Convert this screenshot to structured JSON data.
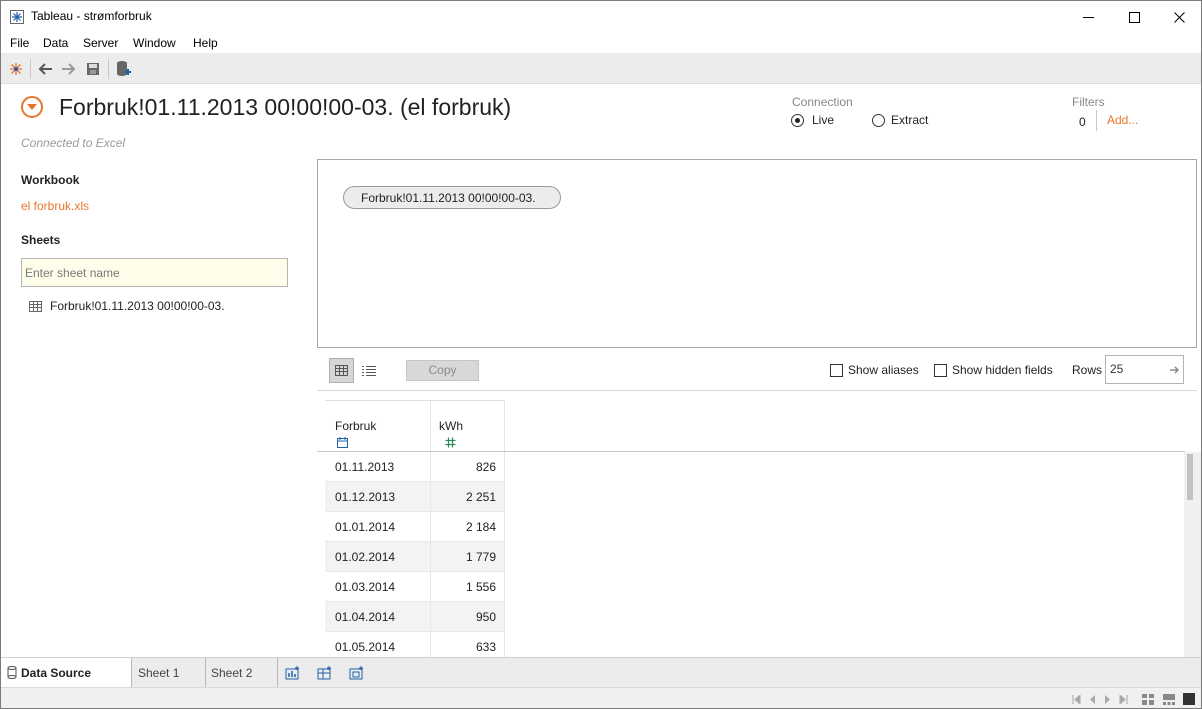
{
  "window": {
    "title": "Tableau - strømforbruk"
  },
  "menu": [
    "File",
    "Data",
    "Server",
    "Window",
    "Help"
  ],
  "datasource": {
    "title": "Forbruk!01.11.2013 00!00!00-03. (el forbruk)",
    "connected_text": "Connected to Excel",
    "connection_label": "Connection",
    "live_label": "Live",
    "extract_label": "Extract",
    "selected_connection": "Live",
    "filters_label": "Filters",
    "filters_count": "0",
    "filters_add": "Add..."
  },
  "left": {
    "workbook_heading": "Workbook",
    "workbook_file": "el forbruk.xls",
    "sheets_heading": "Sheets",
    "sheet_search_placeholder": "Enter sheet name",
    "sheet_item": "Forbruk!01.11.2013 00!00!00-03."
  },
  "canvas": {
    "table_pill": "Forbruk!01.11.2013 00!00!00-03."
  },
  "grid_toolbar": {
    "copy_label": "Copy",
    "show_aliases": "Show aliases",
    "show_hidden": "Show hidden fields",
    "rows_label": "Rows",
    "rows_value": "25"
  },
  "grid": {
    "columns": [
      {
        "name": "Forbruk",
        "type_icon": "calendar-icon"
      },
      {
        "name": "kWh",
        "type_icon": "number-icon"
      }
    ],
    "rows": [
      [
        "01.11.2013",
        "826"
      ],
      [
        "01.12.2013",
        "2 251"
      ],
      [
        "01.01.2014",
        "2 184"
      ],
      [
        "01.02.2014",
        "1 779"
      ],
      [
        "01.03.2014",
        "1 556"
      ],
      [
        "01.04.2014",
        "950"
      ],
      [
        "01.05.2014",
        "633"
      ]
    ]
  },
  "tabs": [
    "Data Source",
    "Sheet 1",
    "Sheet 2"
  ],
  "colors": {
    "accent": "#e8762c",
    "toolbar": "#ececec"
  }
}
